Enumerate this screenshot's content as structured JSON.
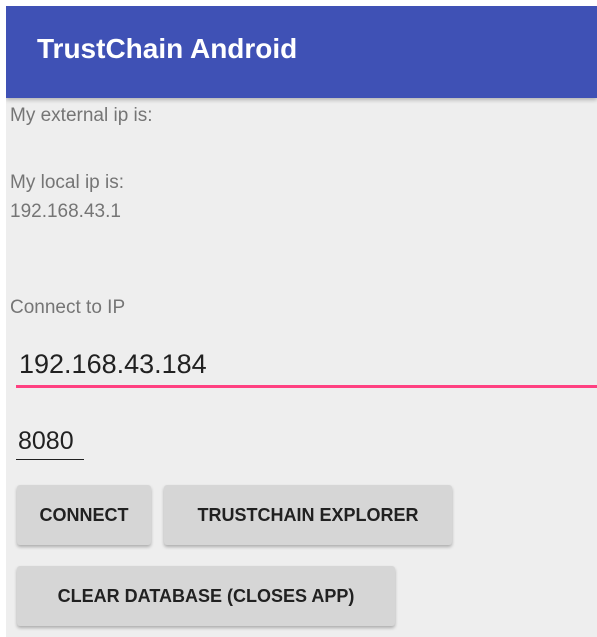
{
  "app_bar": {
    "title": "TrustChain Android"
  },
  "info": {
    "external_ip_label": "My external ip is:",
    "external_ip_value": "",
    "local_ip_label": "My local ip is:",
    "local_ip_value": "192.168.43.1"
  },
  "connect": {
    "label": "Connect to IP",
    "ip_value": "192.168.43.184",
    "port_value": "8080"
  },
  "buttons": {
    "connect": "CONNECT",
    "explorer": "TRUSTCHAIN EXPLORER",
    "clear_database": "CLEAR DATABASE (CLOSES APP)"
  },
  "colors": {
    "primary": "#3f51b5",
    "accent": "#ff4081",
    "background": "#eeeeee",
    "button": "#d6d6d6"
  }
}
